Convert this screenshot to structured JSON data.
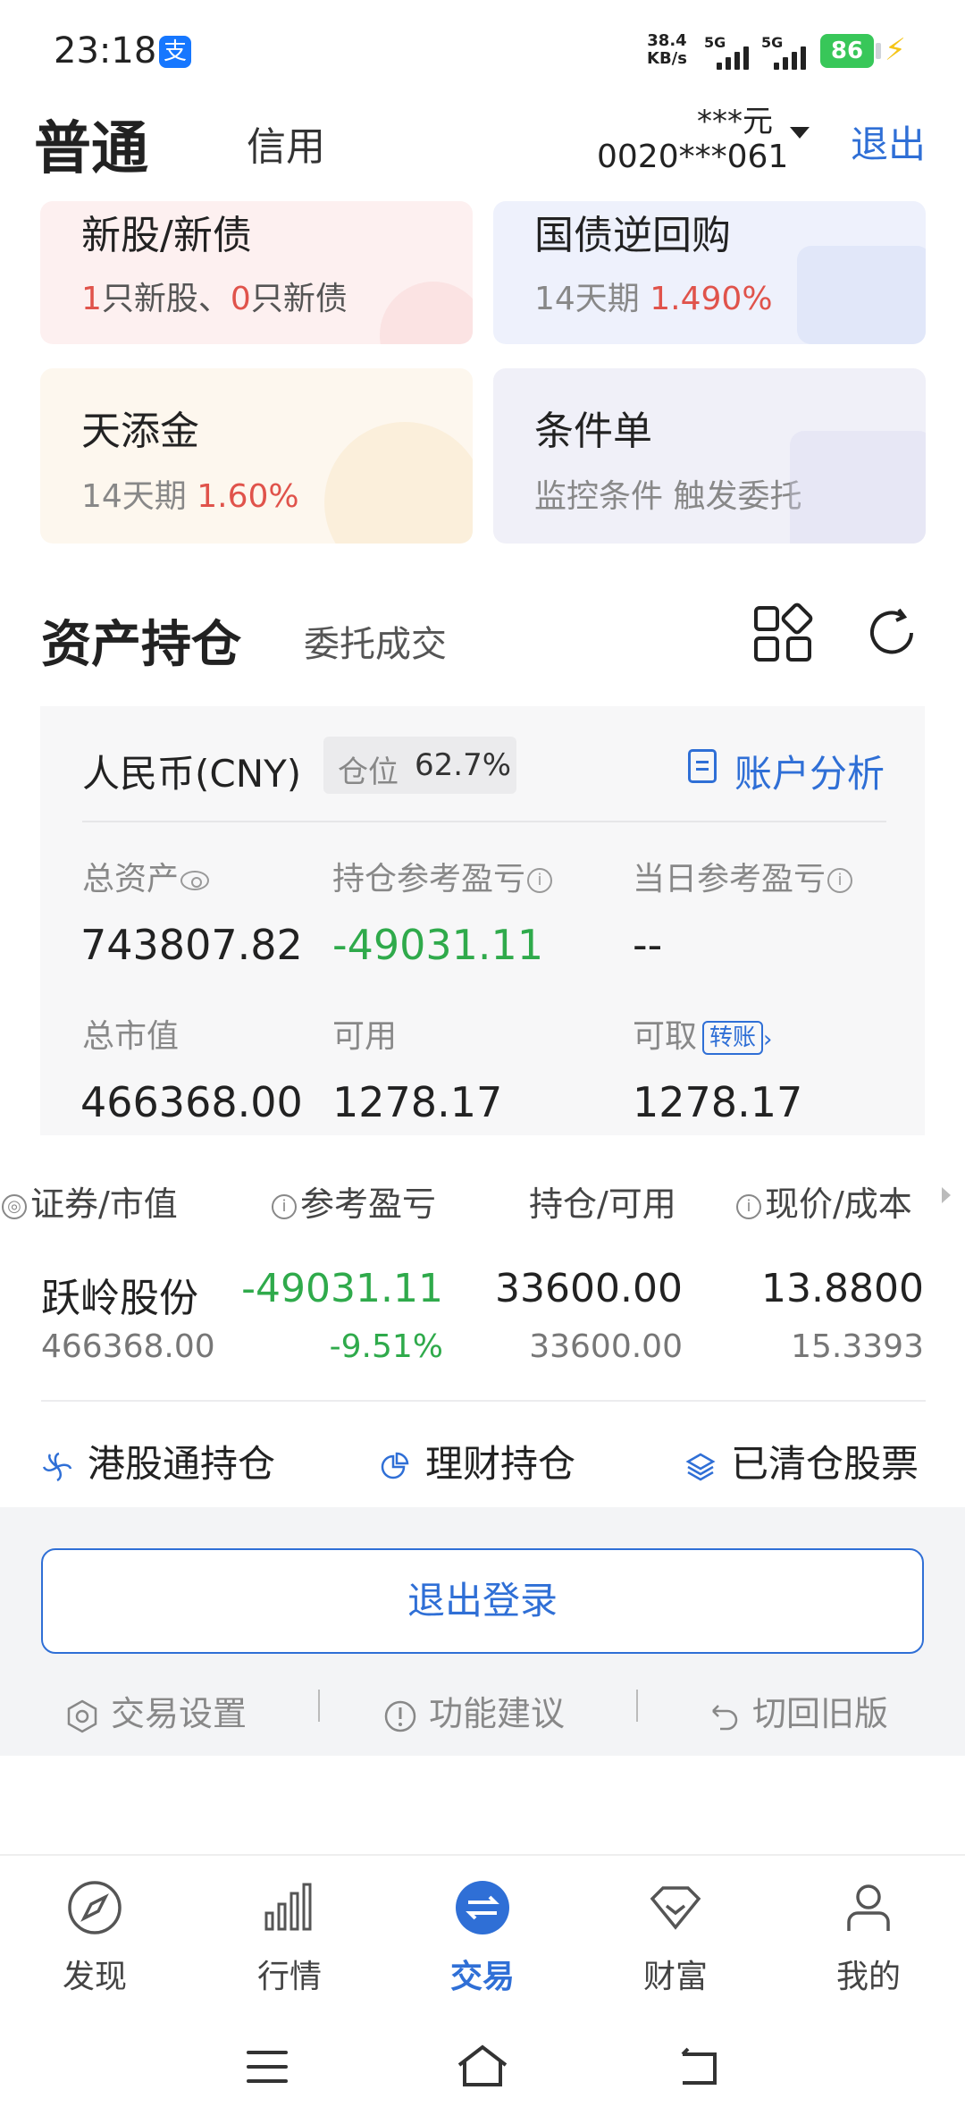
{
  "status_bar": {
    "time": "23:18",
    "net_speed_value": "38.4",
    "net_speed_unit": "KB/s",
    "signal1": "5G",
    "signal2": "5G",
    "battery": "86"
  },
  "header": {
    "tab_normal": "普通",
    "tab_credit": "信用",
    "amount": "***元",
    "account_no": "0020***061",
    "logout": "退出"
  },
  "quick_cards": {
    "ipo": {
      "title": "新股/新债",
      "count_stock": "1",
      "stock_label": "只新股、",
      "count_bond": "0",
      "bond_label": "只新债"
    },
    "repo": {
      "title": "国债逆回购",
      "period": "14天期",
      "rate": "1.490%"
    },
    "ttj": {
      "title": "天添金",
      "period": "14天期",
      "rate": "1.60%"
    },
    "cond": {
      "title": "条件单",
      "desc": "监控条件 触发委托"
    }
  },
  "section": {
    "title": "资产持仓",
    "sub_tab": "委托成交"
  },
  "asset": {
    "currency": "人民币(CNY)",
    "position_label": "仓位",
    "position_value": "62.7%",
    "analysis": "账户分析",
    "total_asset_label": "总资产",
    "total_asset": "743807.82",
    "hold_pnl_label": "持仓参考盈亏",
    "hold_pnl": "-49031.11",
    "day_pnl_label": "当日参考盈亏",
    "day_pnl": "--",
    "market_value_label": "总市值",
    "market_value": "466368.00",
    "available_label": "可用",
    "available": "1278.17",
    "withdrawable_label": "可取",
    "transfer": "转账",
    "withdrawable": "1278.17"
  },
  "holdings_header": {
    "col1": "证券/市值",
    "col2": "参考盈亏",
    "col3": "持仓/可用",
    "col4": "现价/成本"
  },
  "holdings": [
    {
      "name": "跃岭股份",
      "market_value": "466368.00",
      "pnl": "-49031.11",
      "pnl_pct": "-9.51%",
      "position": "33600.00",
      "available": "33600.00",
      "price": "13.8800",
      "cost": "15.3393"
    }
  ],
  "quick_links": {
    "hk": "港股通持仓",
    "wealth": "理财持仓",
    "cleared": "已清仓股票"
  },
  "footer": {
    "logout_button": "退出登录",
    "settings": "交易设置",
    "suggest": "功能建议",
    "old_version": "切回旧版"
  },
  "tabs": [
    {
      "label": "发现",
      "icon": "compass-icon"
    },
    {
      "label": "行情",
      "icon": "bar-chart-icon"
    },
    {
      "label": "交易",
      "icon": "exchange-icon"
    },
    {
      "label": "财富",
      "icon": "diamond-icon"
    },
    {
      "label": "我的",
      "icon": "person-icon"
    }
  ],
  "colors": {
    "accent": "#2f6fd6",
    "loss": "#2faa4b",
    "gain": "#e0534b"
  }
}
